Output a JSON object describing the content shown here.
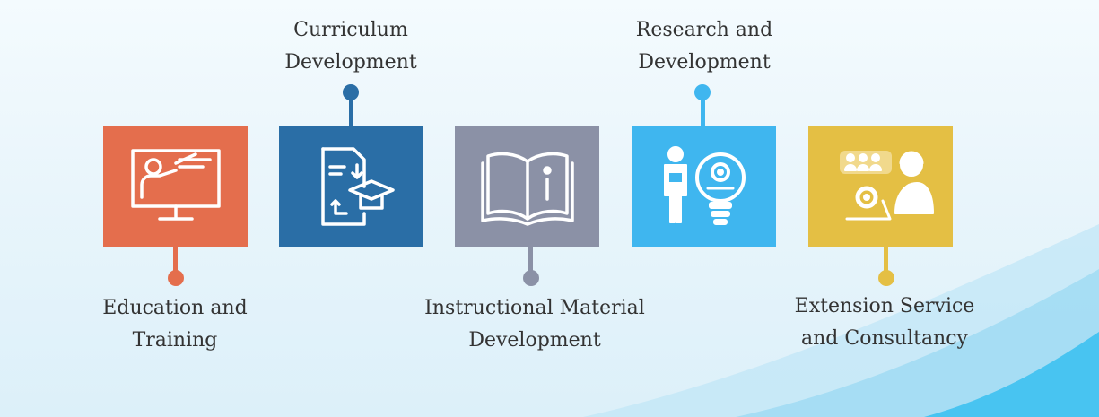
{
  "colors": {
    "education": "#e46e4d",
    "curriculum": "#2a6ea6",
    "instructional": "#8b91a6",
    "research": "#3fb6ef",
    "extension": "#e4bf44"
  },
  "items": [
    {
      "key": "education",
      "icon": "teacher-board-icon",
      "line1": "Education and",
      "line2": "Training"
    },
    {
      "key": "curriculum",
      "icon": "curriculum-document-icon",
      "line1": "Curriculum",
      "line2": "Development"
    },
    {
      "key": "instructional",
      "icon": "open-book-info-icon",
      "line1": "Instructional Material",
      "line2": "Development"
    },
    {
      "key": "research",
      "icon": "scientist-lightbulb-icon",
      "line1": "Research and",
      "line2": "Development"
    },
    {
      "key": "extension",
      "icon": "consultancy-support-icon",
      "line1": "Extension Service",
      "line2": "and Consultancy"
    }
  ]
}
